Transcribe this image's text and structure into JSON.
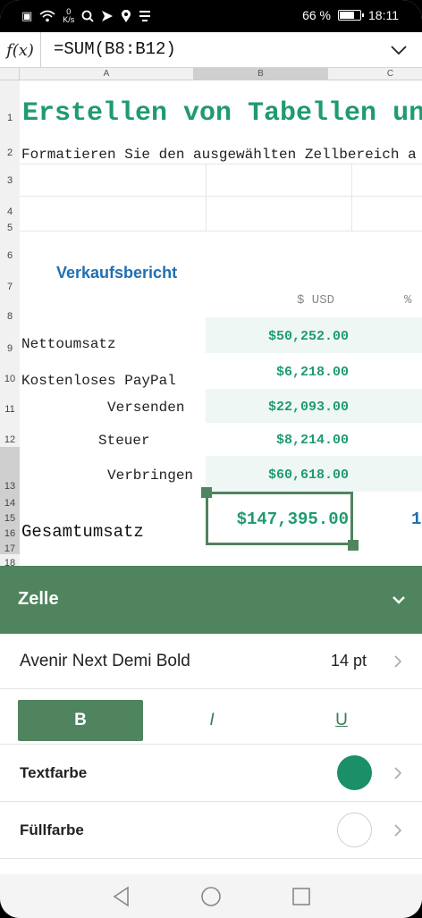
{
  "status": {
    "speed_value": "0",
    "speed_unit": "K/s",
    "battery": "66 %",
    "time": "18:11"
  },
  "formula": {
    "fx_label": "f(x)",
    "text": "=SUM(B8:B12)"
  },
  "columns": [
    "A",
    "B",
    "C"
  ],
  "rows": [
    "1",
    "2",
    "3",
    "4",
    "5",
    "6",
    "7",
    "8",
    "9",
    "10",
    "11",
    "12",
    "13",
    "14",
    "15",
    "16",
    "17",
    "18"
  ],
  "sheet": {
    "title": "Erstellen von Tabellen un",
    "subtitle": "Formatieren Sie den ausgewählten Zellbereich a",
    "report_title": "Verkaufsbericht",
    "col_usd": "$ USD",
    "col_pct": "%",
    "items": [
      {
        "label": "Nettoumsatz",
        "value": "$50,252.00"
      },
      {
        "label": "Kostenloses PayPal",
        "value": "$6,218.00"
      },
      {
        "label": "Versenden",
        "value": "$22,093.00"
      },
      {
        "label": "Steuer",
        "value": "$8,214.00"
      },
      {
        "label": "Verbringen",
        "value": "$60,618.00"
      }
    ],
    "total_label": "Gesamtumsatz",
    "total_value": "$147,395.00",
    "total_pct": "1"
  },
  "panel": {
    "title": "Zelle",
    "font_name": "Avenir Next Demi Bold",
    "font_size": "14 pt",
    "bold_label": "B",
    "italic_label": "I",
    "underline_label": "U",
    "text_color_label": "Textfarbe",
    "fill_color_label": "Füllfarbe",
    "text_color": "#1a8f68",
    "fill_color": "#ffffff"
  },
  "icons": {
    "back": "back-triangle-icon",
    "home": "home-circle-icon",
    "recents": "recents-square-icon"
  }
}
